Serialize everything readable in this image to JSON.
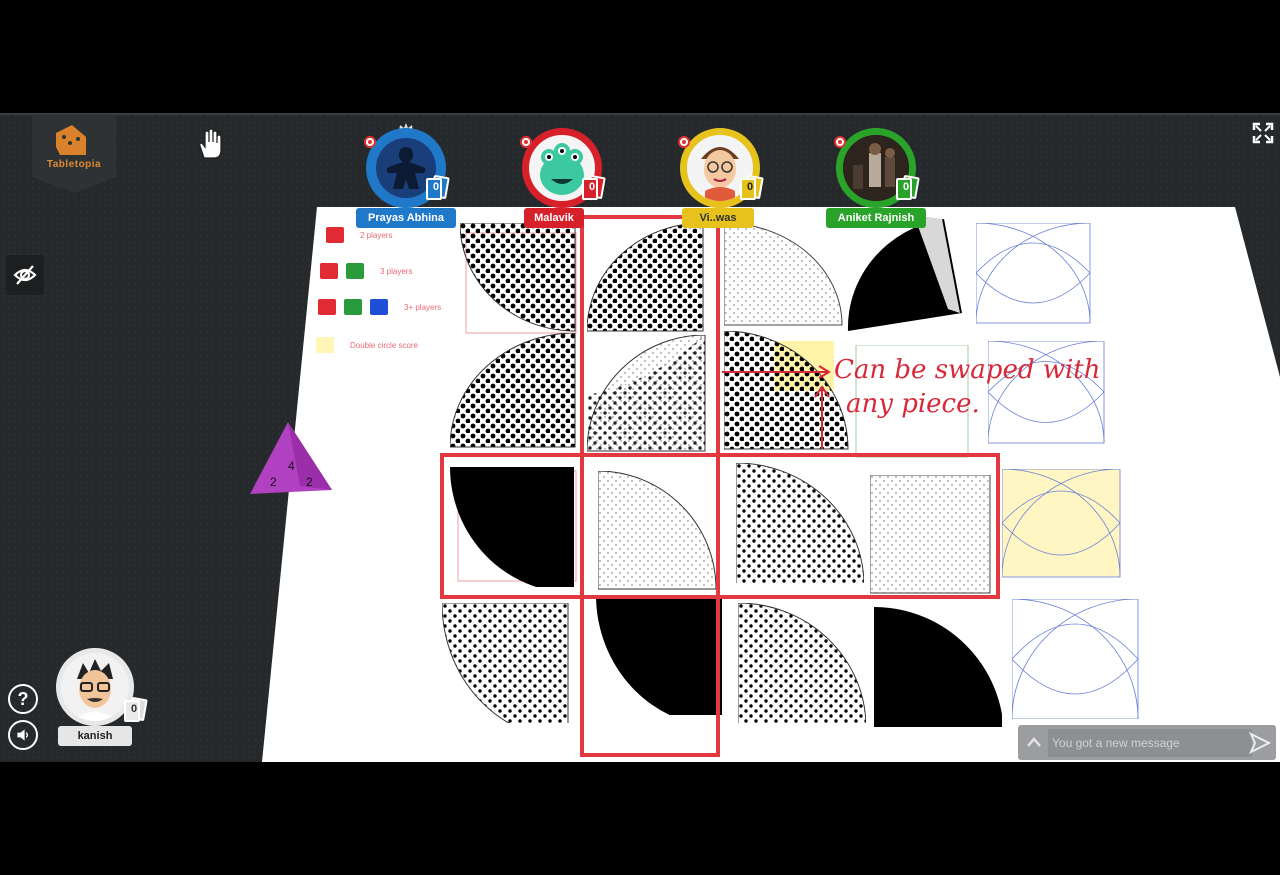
{
  "app": {
    "name": "Tabletopia"
  },
  "players": [
    {
      "name": "Prayas Abhina",
      "color": "#1f78c8",
      "cards": "0",
      "avatar": "meeple-icon",
      "host": true
    },
    {
      "name": "Malavik",
      "color": "#d6212a",
      "cards": "0",
      "avatar": "monster-icon"
    },
    {
      "name": "Vi..was",
      "color": "#e8c21c",
      "cards": "0",
      "avatar": "cartoon-face-icon"
    },
    {
      "name": "Aniket Rajnish",
      "color": "#2aa32a",
      "cards": "0",
      "avatar": "photo-icon"
    }
  ],
  "self_player": {
    "name": "kanish",
    "cards": "0"
  },
  "legend": [
    {
      "label": "2 players",
      "swatches": [
        "#e02a34"
      ]
    },
    {
      "label": "3 players",
      "swatches": [
        "#e02a34",
        "#2a9b3a"
      ]
    },
    {
      "label": "3+ players",
      "swatches": [
        "#e02a34",
        "#2a9b3a",
        "#1f4fd6"
      ]
    },
    {
      "label": "Double circle score",
      "swatches": [
        "#fff6b8"
      ]
    }
  ],
  "annotation": {
    "line1": "Can be swaped with",
    "line2": "any piece."
  },
  "chat": {
    "placeholder": "You got a new message"
  },
  "icons": {
    "hand": "hand-cursor-icon",
    "fullscreen": "fullscreen-icon",
    "eye": "hide-icon",
    "help": "help-icon",
    "sound": "sound-icon",
    "send": "send-icon",
    "chevron": "chevron-up-icon",
    "die": "d4-die-icon"
  },
  "colors": {
    "selection": "#e2383f",
    "annotation": "#d7293a",
    "background": "#26292b"
  }
}
